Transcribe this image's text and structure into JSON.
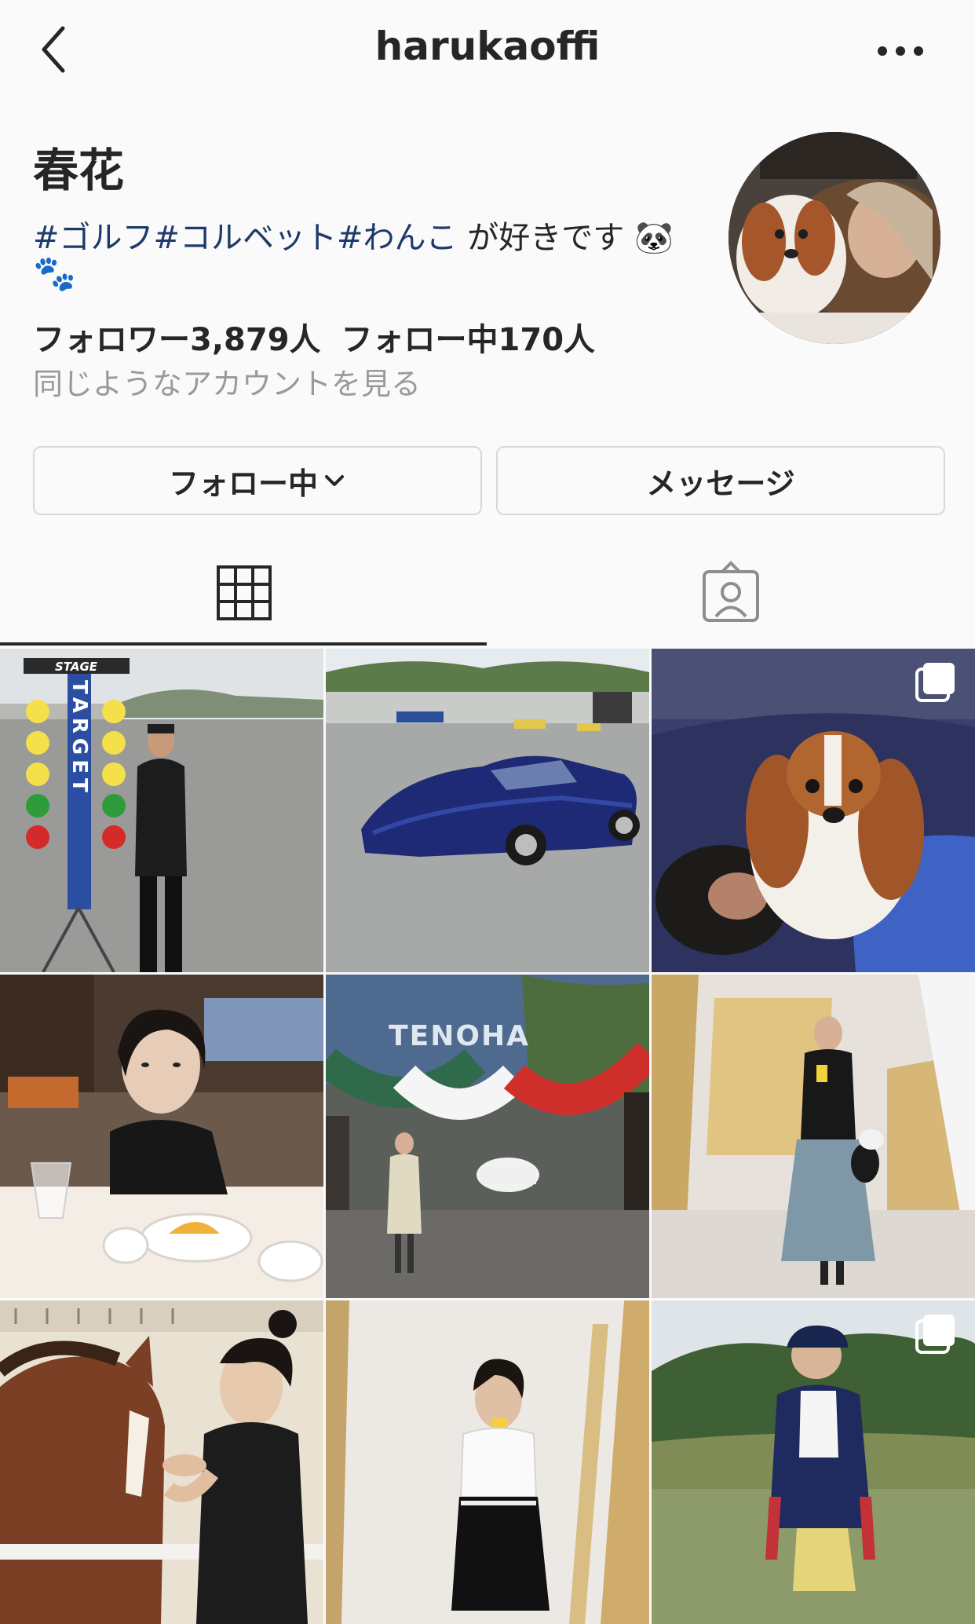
{
  "header": {
    "username": "harukaoffi",
    "back_icon": "chevron-left-icon",
    "more_icon": "more-horizontal-icon"
  },
  "profile": {
    "display_name": "春花",
    "bio": {
      "hashtags": [
        "#ゴルフ",
        "#コルベット",
        "#わんこ"
      ],
      "text": " が好きです",
      "emoji_panda": "🐼",
      "emoji_paws": "🐾"
    },
    "followers": "フォロワー3,879人",
    "following": "フォロー中170人",
    "similar_accounts": "同じようなアカウントを見る"
  },
  "actions": {
    "follow_label": "フォロー中",
    "message_label": "メッセージ"
  },
  "tabs": [
    {
      "name": "grid",
      "icon": "grid-icon",
      "active": true
    },
    {
      "name": "tagged",
      "icon": "tagged-person-icon",
      "active": false
    }
  ],
  "posts": [
    {
      "subject": "drag-strip-woman",
      "multiple": false
    },
    {
      "subject": "blue-corvette",
      "multiple": false
    },
    {
      "subject": "dog-and-woman",
      "multiple": true
    },
    {
      "subject": "woman-at-cafe",
      "multiple": false
    },
    {
      "subject": "tenoha-entrance",
      "multiple": false
    },
    {
      "subject": "mirror-selfie-skirt",
      "multiple": false
    },
    {
      "subject": "woman-with-horse",
      "multiple": false
    },
    {
      "subject": "mirror-selfie-dress",
      "multiple": false
    },
    {
      "subject": "golf-outfit",
      "multiple": true
    }
  ],
  "post_text": {
    "stage": "STAGE",
    "target": "TARGET",
    "tenoha": "TENOHA"
  },
  "colors": {
    "text": "#262626",
    "hashtag": "#1d3a6b",
    "secondary": "#9a9a9a",
    "background": "#fafafa",
    "border": "#d8d8d8"
  }
}
